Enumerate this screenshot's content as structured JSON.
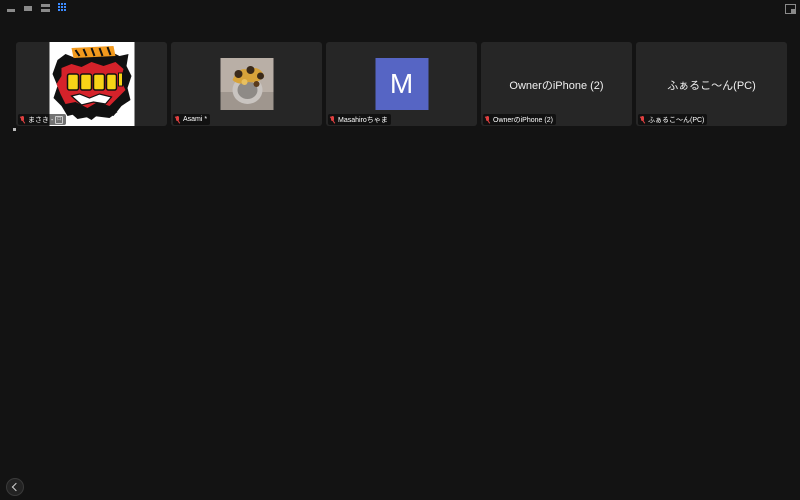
{
  "toolbar": {
    "view_icons": [
      "speaker-view-icon",
      "gallery-view-icon",
      "stacked-view-icon",
      "grid-view-icon"
    ],
    "active_view": "grid-view-icon",
    "fullscreen_icon": "fullscreen-icon"
  },
  "participants": [
    {
      "name": "まさき -",
      "badge": "日",
      "display": "logo",
      "muted": true
    },
    {
      "name": "Asami *",
      "display": "photo",
      "muted": true
    },
    {
      "name": "Masahiroちゃま",
      "display": "avatar",
      "initial": "M",
      "avatar_color": "#5665c4",
      "muted": true
    },
    {
      "name": "OwnerのiPhone (2)",
      "display": "name",
      "big_name": "OwnerのiPhone (2)",
      "muted": true
    },
    {
      "name": "ふぁるこ〜ん(PC)",
      "display": "name",
      "big_name": "ふぁるこ〜ん(PC)",
      "muted": true
    }
  ],
  "colors": {
    "background": "#131313",
    "tile": "#262626",
    "muted_mic": "#e04040",
    "active_view": "#3d8bff"
  },
  "collapse": {
    "icon": "chevron-left-icon"
  }
}
